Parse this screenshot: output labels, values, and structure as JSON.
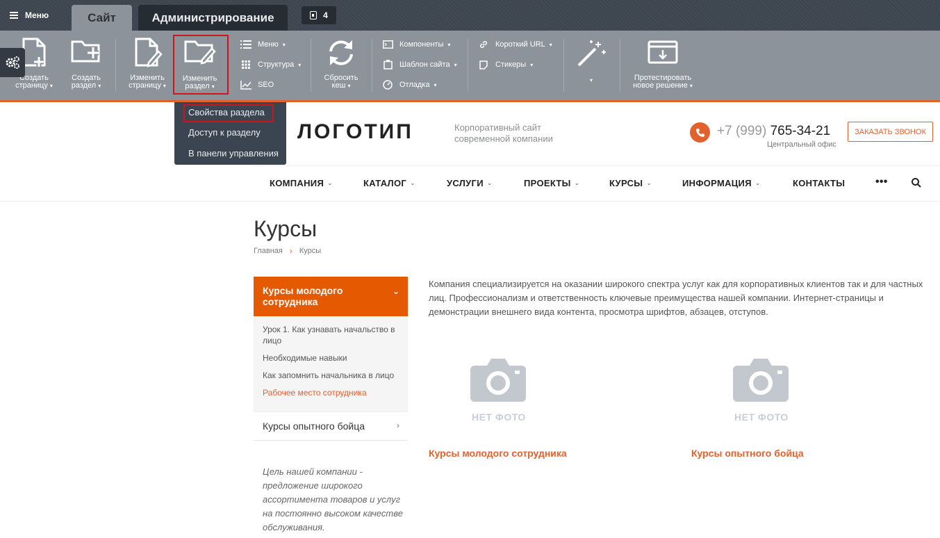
{
  "admin": {
    "menu_label": "Меню",
    "tab_site": "Сайт",
    "tab_admin": "Администрирование",
    "notifications_count": "4",
    "buttons": {
      "create_page": [
        "Создать",
        "страницу"
      ],
      "create_section": [
        "Создать",
        "раздел"
      ],
      "edit_page": [
        "Изменить",
        "страницу"
      ],
      "edit_section": [
        "Изменить",
        "раздел"
      ],
      "reset_cache": [
        "Сбросить",
        "кеш"
      ],
      "test_solution": [
        "Протестировать",
        "новое решение"
      ]
    },
    "small": {
      "menu": "Меню",
      "structure": "Структура",
      "seo": "SEO",
      "components": "Компоненты",
      "site_template": "Шаблон сайта",
      "debug": "Отладка",
      "short_url": "Короткий URL",
      "stickers": "Стикеры"
    },
    "dropdown": [
      "Свойства раздела",
      "Доступ к разделу",
      "В панели управления"
    ]
  },
  "header": {
    "logo_text": "ЛОГОТИП",
    "tagline": [
      "Корпоративный сайт",
      "современной компании"
    ],
    "phone_prefix": "+7 (999)",
    "phone_number": "765-34-21",
    "office": "Центральный офис",
    "callback_button": "ЗАКАЗАТЬ ЗВОНОК"
  },
  "nav": [
    "КОМПАНИЯ",
    "КАТАЛОГ",
    "УСЛУГИ",
    "ПРОЕКТЫ",
    "КУРСЫ",
    "ИНФОРМАЦИЯ",
    "КОНТАКТЫ"
  ],
  "page": {
    "title": "Курсы",
    "breadcrumbs": [
      "Главная",
      "Курсы"
    ],
    "intro": "Компания специализируется на оказании широкого спектра услуг как для корпоративных клиентов так и для частных лиц. Профессионализм и ответственность ключевые преимущества нашей компании. Интернет-страницы и демонстрации внешнего вида контента, просмотра шрифтов, абзацев, отступов."
  },
  "sidebar": {
    "active_section": "Курсы молодого сотрудника",
    "sub_items": [
      "Урок 1. Как узнавать начальство в лицо",
      "Необходимые навыки",
      "Как запомнить начальника в лицо",
      "Рабочее место сотрудника"
    ],
    "second_section": "Курсы опытного бойца",
    "quote": "Цель нашей компании - предложение широкого ассортимента товаров и услуг на постоянно высоком качестве обслуживания."
  },
  "cards": [
    {
      "nofoto": "НЕТ ФОТО",
      "title": "Курсы молодого сотрудника"
    },
    {
      "nofoto": "НЕТ ФОТО",
      "title": "Курсы опытного бойца"
    }
  ],
  "colors": {
    "accent": "#e2612c",
    "admin_dark": "#3e4651",
    "toolbar": "#8c939b",
    "highlight": "#d0141b"
  }
}
